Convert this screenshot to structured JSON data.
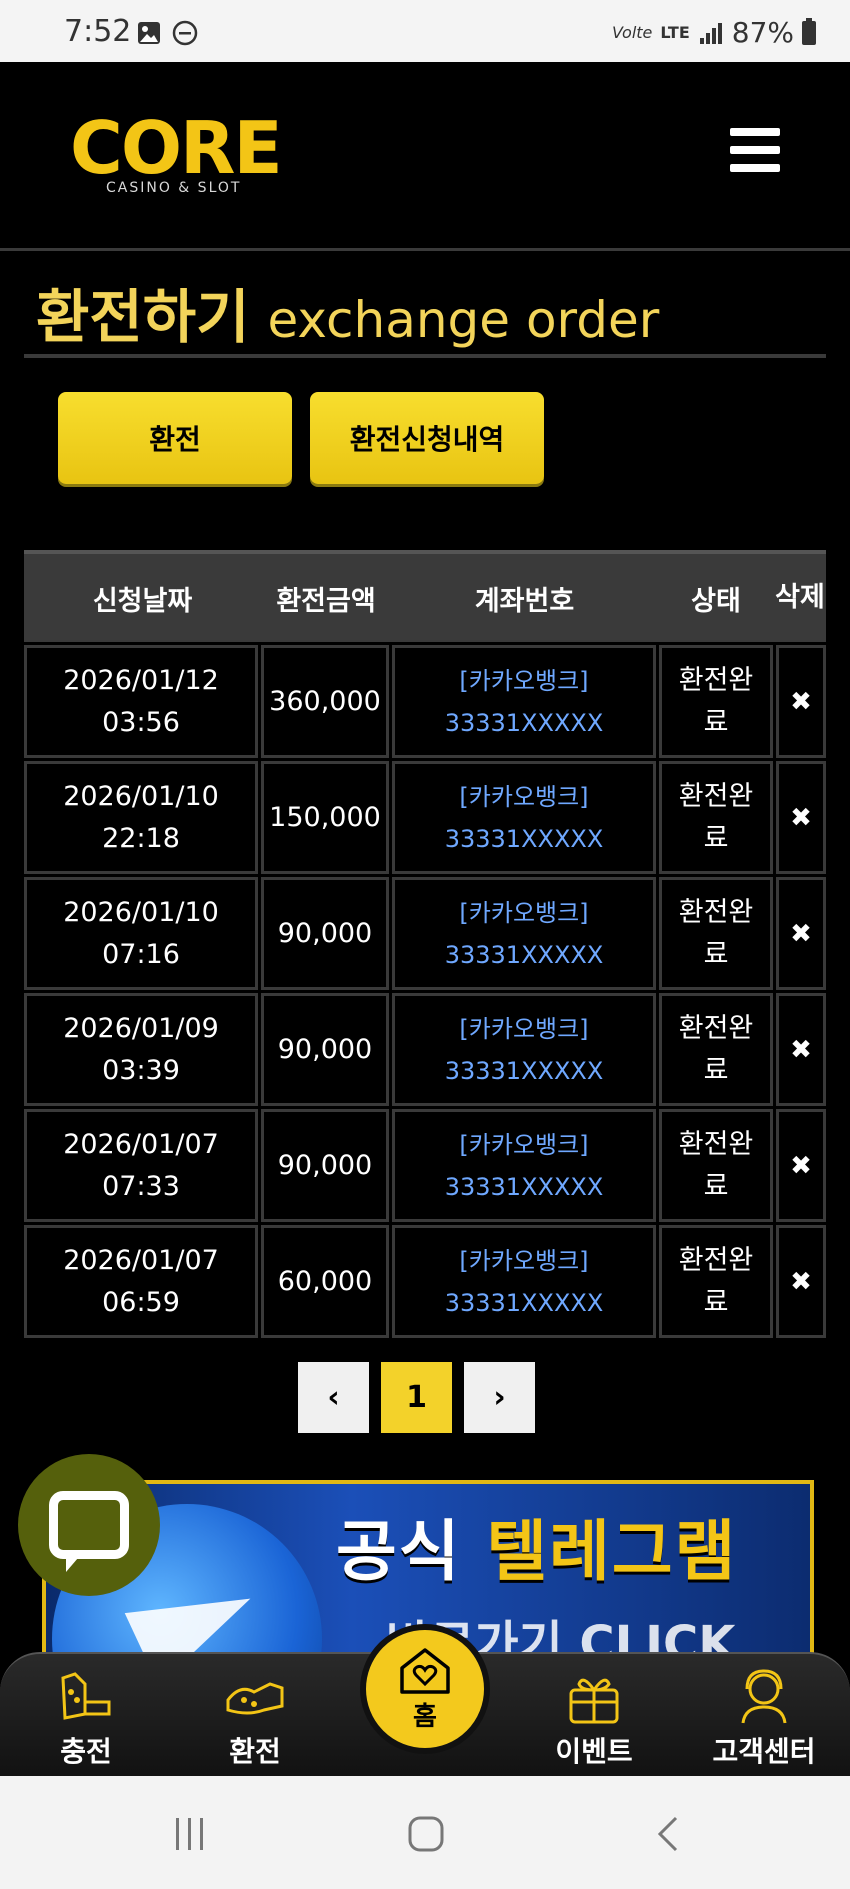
{
  "status_bar": {
    "time": "7:52",
    "volte": "Volte",
    "network": "LTE",
    "battery": "87%"
  },
  "header": {
    "logo_text": "CORE",
    "logo_sub": "CASINO & SLOT"
  },
  "page": {
    "title_ko": "환전하기",
    "title_en": "exchange order"
  },
  "tabs": [
    {
      "label": "환전"
    },
    {
      "label": "환전신청내역"
    }
  ],
  "table": {
    "headers": [
      "신청날짜",
      "환전금액",
      "계좌번호",
      "상태",
      "삭제"
    ],
    "rows": [
      {
        "date": "2026/01/12",
        "time": "03:56",
        "amount": "360,000",
        "bank": "[카카오뱅크]",
        "account": "33331XXXXX",
        "status": "환전완료"
      },
      {
        "date": "2026/01/10",
        "time": "22:18",
        "amount": "150,000",
        "bank": "[카카오뱅크]",
        "account": "33331XXXXX",
        "status": "환전완료"
      },
      {
        "date": "2026/01/10",
        "time": "07:16",
        "amount": "90,000",
        "bank": "[카카오뱅크]",
        "account": "33331XXXXX",
        "status": "환전완료"
      },
      {
        "date": "2026/01/09",
        "time": "03:39",
        "amount": "90,000",
        "bank": "[카카오뱅크]",
        "account": "33331XXXXX",
        "status": "환전완료"
      },
      {
        "date": "2026/01/07",
        "time": "07:33",
        "amount": "90,000",
        "bank": "[카카오뱅크]",
        "account": "33331XXXXX",
        "status": "환전완료"
      },
      {
        "date": "2026/01/07",
        "time": "06:59",
        "amount": "60,000",
        "bank": "[카카오뱅크]",
        "account": "33331XXXXX",
        "status": "환전완료"
      }
    ],
    "delete_glyph": "✖"
  },
  "pagination": {
    "prev": "‹",
    "current": "1",
    "next": "›"
  },
  "banner": {
    "title_white": "공식 ",
    "title_yellow": "텔레그램",
    "subtitle": "바로가기 CLICK"
  },
  "bottom_nav": [
    {
      "label": "충전",
      "icon": "deposit-icon"
    },
    {
      "label": "환전",
      "icon": "exchange-icon"
    },
    {
      "label": "홈",
      "icon": "home-heart-icon"
    },
    {
      "label": "이벤트",
      "icon": "gift-icon"
    },
    {
      "label": "고객센터",
      "icon": "support-icon"
    }
  ],
  "colors": {
    "accent": "#f3c516",
    "link": "#6fa8ff",
    "table_header": "#3a3a3a"
  }
}
